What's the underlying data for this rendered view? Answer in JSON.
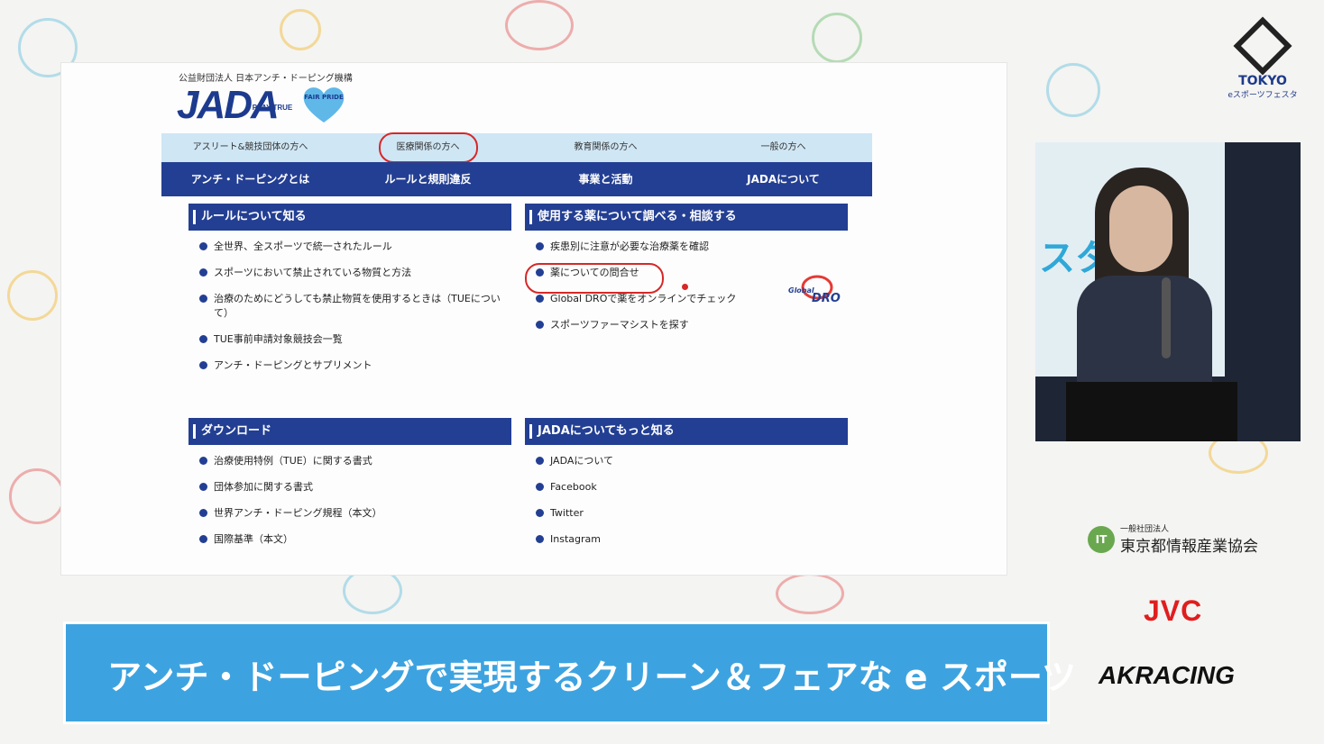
{
  "slide": {
    "org_name": "公益財団法人 日本アンチ・ドーピング機構",
    "logo": "JADA",
    "logo_sub": "PLAY TRUE",
    "badge": "FAIR PRIDE",
    "top_nav": [
      "アスリート&競技団体の方へ",
      "医療関係の方へ",
      "教育関係の方へ",
      "一般の方へ"
    ],
    "main_nav": [
      "アンチ・ドーピングとは",
      "ルールと規則違反",
      "事業と活動",
      "JADAについて"
    ],
    "sections": [
      {
        "title": "ルールについて知る",
        "items": [
          "全世界、全スポーツで統一されたルール",
          "スポーツにおいて禁止されている物質と方法",
          "治療のためにどうしても禁止物質を使用するときは（TUEについて）",
          "TUE事前申請対象競技会一覧",
          "アンチ・ドーピングとサプリメント"
        ]
      },
      {
        "title": "使用する薬について調べる・相談する",
        "items": [
          "疾患別に注意が必要な治療薬を確認",
          "薬についての問合せ",
          "Global DROで薬をオンラインでチェック",
          "スポーツファーマシストを探す"
        ]
      },
      {
        "title": "ダウンロード",
        "items": [
          "治療使用特例（TUE）に関する書式",
          "団体参加に関する書式",
          "世界アンチ・ドーピング規程（本文）",
          "国際基準（本文）"
        ]
      },
      {
        "title": "JADAについてもっと知る",
        "items": [
          "JADAについて",
          "Facebook",
          "Twitter",
          "Instagram"
        ]
      }
    ],
    "dro_label": "Global",
    "dro_mark": "DRO"
  },
  "video": {
    "wall_text": "スタ"
  },
  "logos": {
    "tokyo": "TOKYO",
    "tokyo_sub": "eスポーツフェスタ",
    "assoc_small": "一般社団法人",
    "assoc_big": "東京都情報産業協会",
    "assoc_badge": "IT",
    "jvc": "JVC",
    "akracing": "AKRACING"
  },
  "banner": {
    "text": "アンチ・ドーピングで実現するクリーン＆フェアな e スポーツ"
  },
  "colors": {
    "navy": "#233f93",
    "light_blue": "#cfe6f4",
    "banner": "#3da3e0",
    "highlight": "#d62828"
  }
}
